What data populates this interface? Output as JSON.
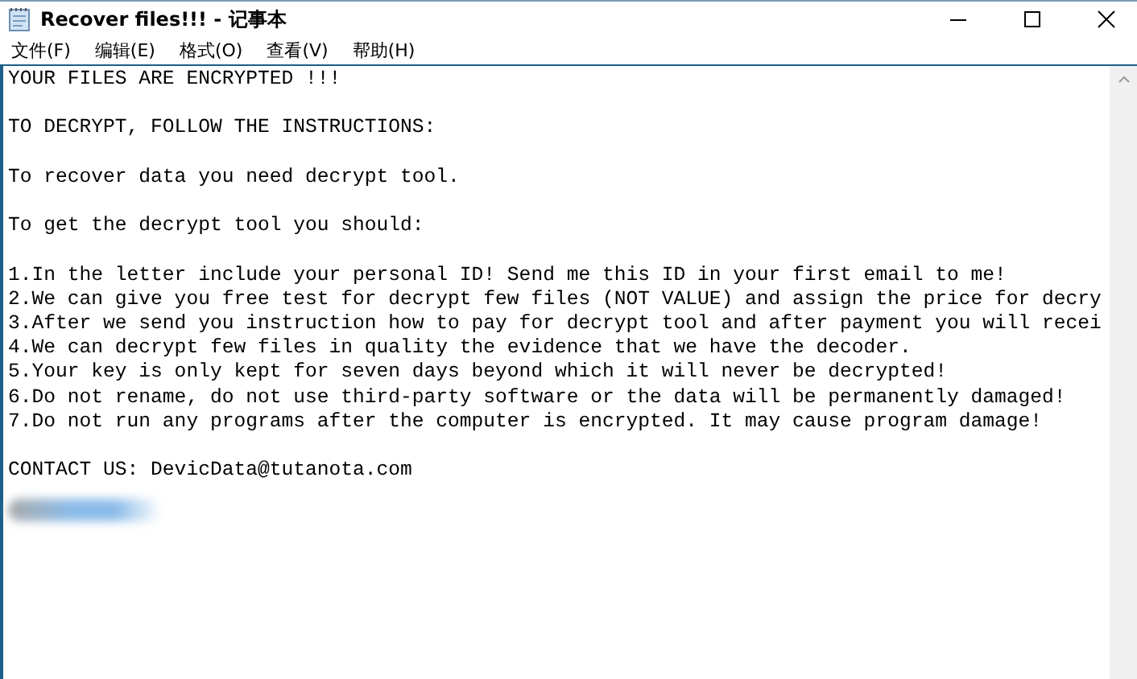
{
  "window": {
    "title": "Recover files!!! - 记事本"
  },
  "menu": [
    "文件(F)",
    "编辑(E)",
    "格式(O)",
    "查看(V)",
    "帮助(H)"
  ],
  "document": {
    "blocks": [
      {
        "lines": [
          "YOUR FILES ARE ENCRYPTED !!!"
        ]
      },
      {
        "lines": [
          "TO DECRYPT, FOLLOW THE INSTRUCTIONS:"
        ]
      },
      {
        "lines": [
          "To recover data you need decrypt tool."
        ]
      },
      {
        "lines": [
          "To get the decrypt tool you should:"
        ]
      },
      {
        "lines": [
          "1.In the letter include your personal ID! Send me this ID in your first email to me!",
          "2.We can give you free test for decrypt few files (NOT VALUE) and assign the price for decry",
          "3.After we send you instruction how to pay for decrypt tool and after payment you will recei",
          "4.We can decrypt few files in quality the evidence that we have the decoder.",
          "5.Your key is only kept for seven days beyond which it will never be decrypted!",
          "6.Do not rename, do not use third-party software or the data will be permanently damaged!",
          "7.Do not run any programs after the computer is encrypted. It may cause program damage!"
        ]
      },
      {
        "lines": [
          "CONTACT US: DevicData@tutanota.com"
        ]
      }
    ]
  }
}
